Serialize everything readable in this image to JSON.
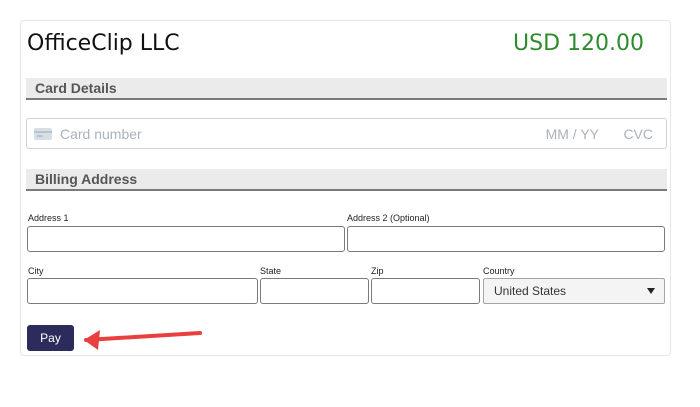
{
  "header": {
    "merchant": "OfficeClip LLC",
    "amount": "USD 120.00"
  },
  "sections": {
    "card_details": "Card Details",
    "billing_address": "Billing Address"
  },
  "card_field": {
    "placeholder": "Card number",
    "expiry_placeholder": "MM / YY",
    "cvc_placeholder": "CVC"
  },
  "billing": {
    "address1_label": "Address 1",
    "address1_value": "",
    "address2_label": "Address 2 (Optional)",
    "address2_value": "",
    "city_label": "City",
    "city_value": "",
    "state_label": "State",
    "state_value": "",
    "zip_label": "Zip",
    "zip_value": "",
    "country_label": "Country",
    "country_value": "United States"
  },
  "actions": {
    "pay_label": "Pay"
  },
  "colors": {
    "amount": "#2e8b2e",
    "pay_button": "#2b2c5c",
    "annotation_arrow": "#e8403f"
  }
}
